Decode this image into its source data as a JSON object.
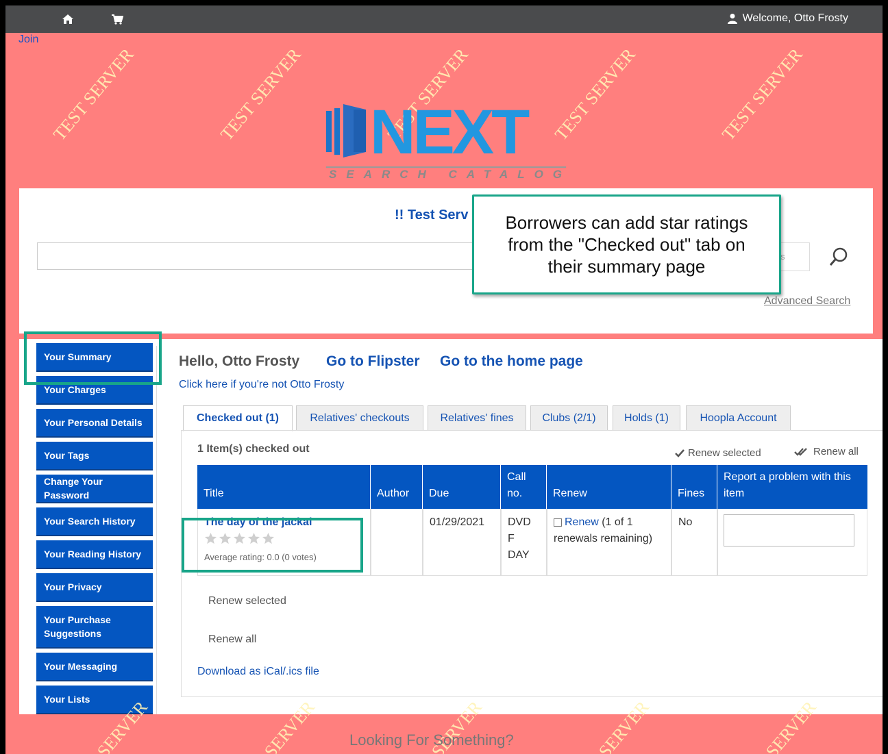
{
  "topbar": {
    "welcome": "Welcome, Otto Frosty"
  },
  "join": "Join",
  "watermark": "TEST SERVER",
  "watermark_bottom": "SERVER",
  "logo": {
    "word": "NEXT",
    "tagline": "SEARCH CATALOG"
  },
  "search": {
    "title": "!! Test Serv",
    "type_hint": "ies",
    "advanced": "Advanced Search"
  },
  "sidebar": {
    "items": [
      {
        "label": "Your Summary"
      },
      {
        "label": "Your Charges"
      },
      {
        "label": "Your Personal Details"
      },
      {
        "label": "Your Tags"
      },
      {
        "label": "Change Your Password"
      },
      {
        "label": "Your Search History"
      },
      {
        "label": "Your Reading History"
      },
      {
        "label": "Your Privacy"
      },
      {
        "label": "Your Purchase Suggestions"
      },
      {
        "label": "Your Messaging"
      },
      {
        "label": "Your Lists"
      }
    ]
  },
  "main": {
    "hello": "Hello, Otto Frosty",
    "go_flipster": "Go to Flipster",
    "go_home": "Go to the home page",
    "not_user": "Click here if you're not Otto Frosty",
    "tabs": [
      {
        "label": "Checked out (1)"
      },
      {
        "label": "Relatives' checkouts"
      },
      {
        "label": "Relatives' fines"
      },
      {
        "label": "Clubs (2/1)"
      },
      {
        "label": "Holds (1)"
      },
      {
        "label": "Hoopla Account"
      }
    ],
    "count": "1 Item(s) checked out",
    "renew_selected": "Renew selected",
    "renew_all": "Renew all",
    "table": {
      "headers": [
        "Title",
        "Author",
        "Due",
        "Call no.",
        "Renew",
        "Fines",
        "Report a problem with this item"
      ],
      "row": {
        "title": "The day of the jackal",
        "rating_stars": 0,
        "average_rating": "Average rating: 0.0 (0 votes)",
        "author": "",
        "due": "01/29/2021",
        "call_no": "DVD F DAY",
        "renew_link": "Renew",
        "renew_note": " (1 of 1 renewals remaining)",
        "fines": "No"
      }
    },
    "renew_selected_bottom": "Renew selected",
    "renew_all_bottom": "Renew all",
    "ical": "Download as iCal/.ics file"
  },
  "footer": {
    "text": "Looking For Something?"
  },
  "callout": {
    "text": "Borrowers can add star ratings from the \"Checked out\" tab on their summary page"
  },
  "colors": {
    "page_bg": "#ff7f7e",
    "topbar": "#4a4b4d",
    "sidebar": "#0456c1",
    "highlight": "#18a589",
    "link": "#1553b3"
  }
}
